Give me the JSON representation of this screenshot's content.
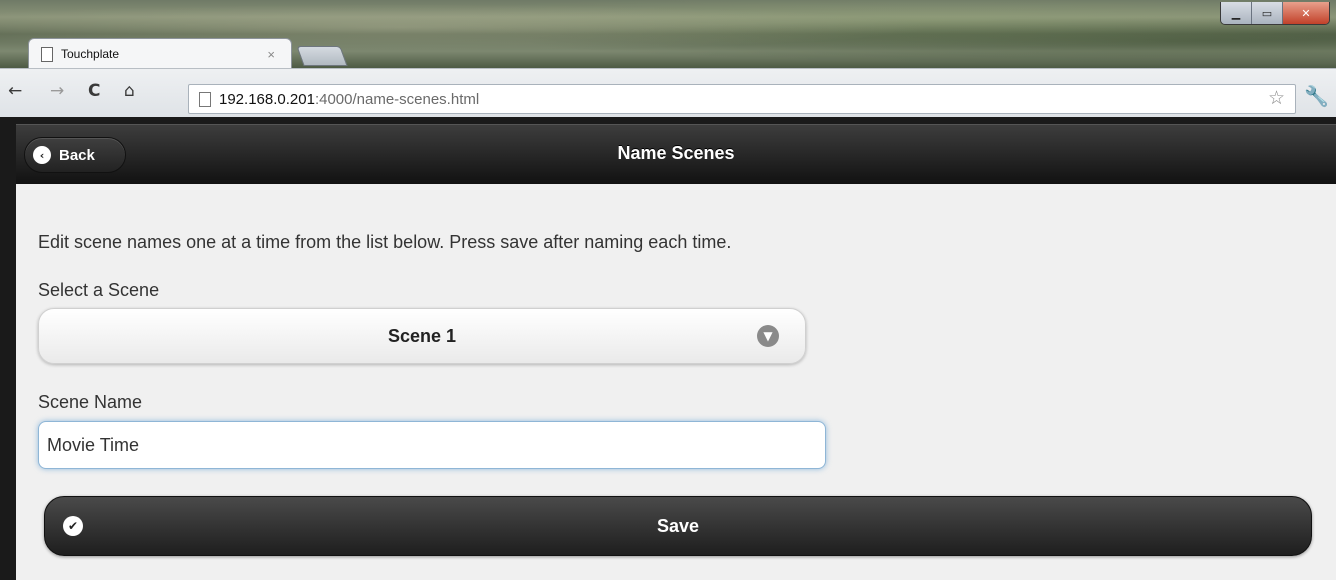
{
  "browser": {
    "tab_title": "Touchplate",
    "tab_close": "×",
    "address_host": "192.168.0.201",
    "address_path": ":4000/name-scenes.html"
  },
  "header": {
    "back_label": "Back",
    "title": "Name Scenes"
  },
  "content": {
    "instructions": "Edit scene names one at a time from the list below. Press save after naming each time.",
    "select_label": "Select a Scene",
    "selected_scene": "Scene 1",
    "name_label": "Scene Name",
    "name_value": "Movie Time",
    "save_label": "Save"
  },
  "icons": {
    "back": "chevron-left-icon",
    "select": "chevron-down-icon",
    "save": "check-icon"
  }
}
